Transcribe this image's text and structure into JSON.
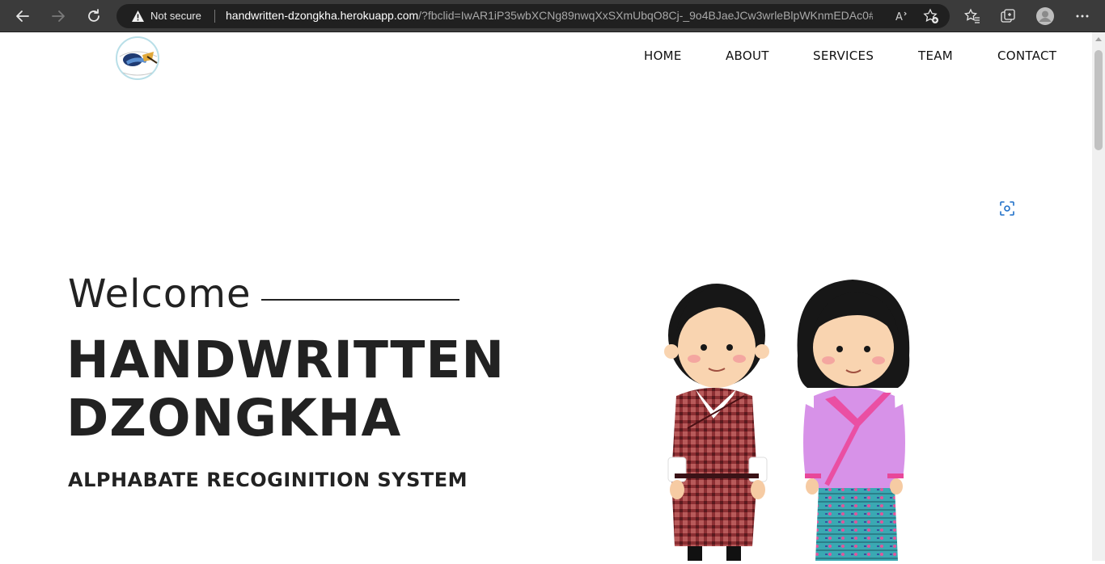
{
  "browser": {
    "security_label": "Not secure",
    "url_host": "handwritten-dzongkha.herokuapp.com",
    "url_path": "/?fbclid=IwAR1iP35wbXCNg89nwqXxSXmUbqO8Cj-_9o4BJaeJCw3wrleBlpWKnmEDAc0#",
    "icons": [
      "back-arrow-icon",
      "forward-arrow-icon",
      "refresh-icon",
      "warning-icon",
      "read-aloud-icon",
      "add-favorite-icon",
      "favorites-icon",
      "collections-icon",
      "profile-icon",
      "more-icon"
    ]
  },
  "nav": {
    "items": [
      {
        "label": "HOME"
      },
      {
        "label": "ABOUT"
      },
      {
        "label": "SERVICES"
      },
      {
        "label": "TEAM"
      },
      {
        "label": "CONTACT"
      }
    ]
  },
  "hero": {
    "welcome": "Welcome",
    "title_line1": "HANDWRITTEN",
    "title_line2": "DZONGKHA",
    "subtitle": "ALPHABATE RECOGINITION SYSTEM"
  },
  "colors": {
    "chrome_bg": "#3b3b3b",
    "address_bg": "#202020",
    "text_dark": "#222222",
    "accent_blue": "#1e6fc8"
  }
}
